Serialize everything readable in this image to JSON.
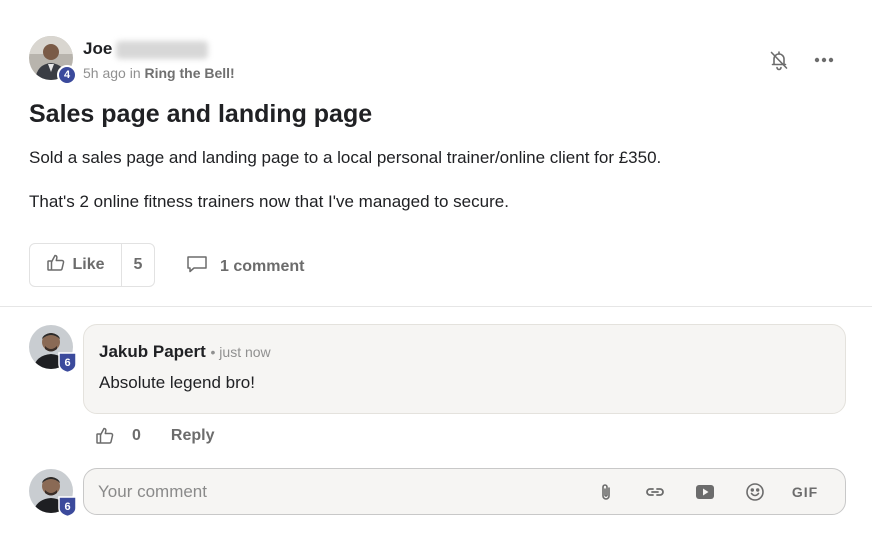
{
  "post": {
    "author_first_name": "Joe",
    "author_level": "4",
    "time_ago": "5h ago in",
    "category": "Ring the Bell!",
    "title": "Sales page and landing page",
    "paragraphs": [
      "Sold a sales page and landing page to a local personal trainer/online client for £350.",
      "That's 2 online fitness trainers now that I've managed to secure."
    ],
    "like_label": "Like",
    "like_count": "5",
    "comments_label": "1 comment"
  },
  "comment": {
    "author": "Jakub Papert",
    "time": "• just now",
    "text": "Absolute legend bro!",
    "author_level": "6",
    "like_count": "0",
    "reply_label": "Reply"
  },
  "composer": {
    "placeholder": "Your comment",
    "user_level": "6",
    "gif_label": "GIF"
  },
  "colors": {
    "badge": "#3b4a9c",
    "text": "#202124",
    "muted": "#6c6c6c"
  },
  "icons": [
    "bell-off-icon",
    "more-icon",
    "thumbs-up-icon",
    "comment-icon",
    "paperclip-icon",
    "link-icon",
    "video-icon",
    "emoji-icon",
    "gif-icon"
  ]
}
